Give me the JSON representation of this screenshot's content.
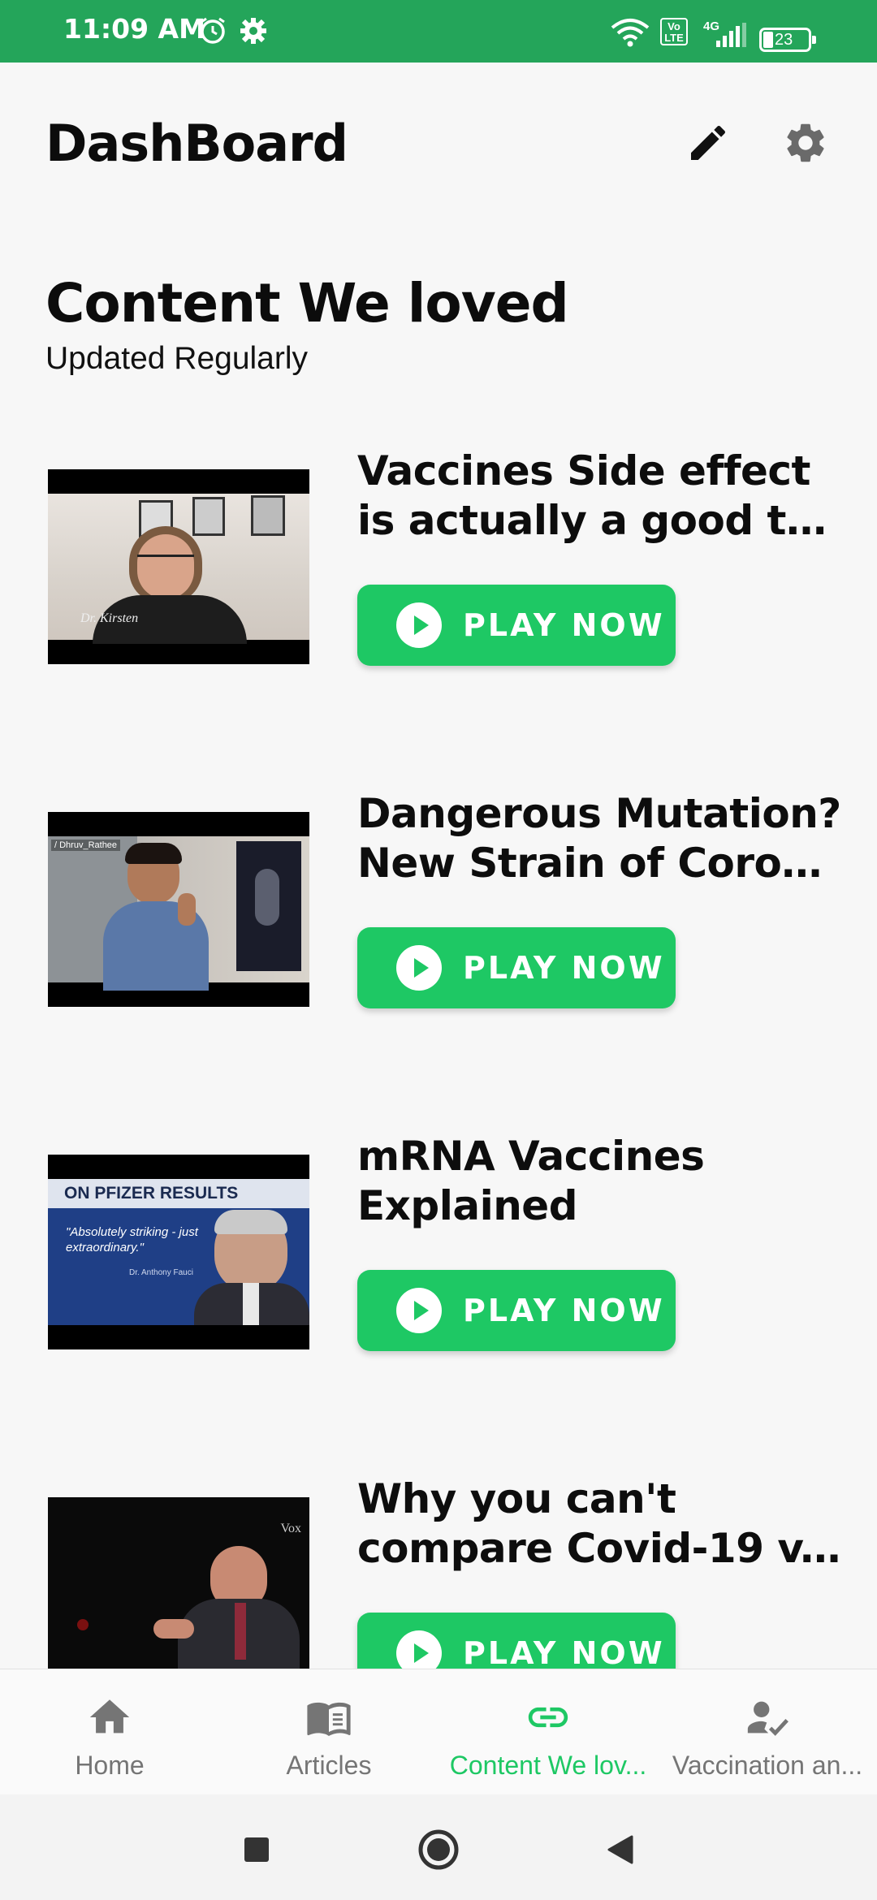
{
  "status_bar": {
    "time": "11:09 AM",
    "battery": "23",
    "volte": "Vo LTE",
    "network": "4G"
  },
  "app_bar": {
    "title": "DashBoard",
    "edit_icon": "pencil-icon",
    "settings_icon": "gear-icon"
  },
  "section": {
    "title": "Content We loved",
    "subtitle": "Updated Regularly"
  },
  "content_items": [
    {
      "title_line1": "Vaccines Side effect",
      "title_line2": "is actually a good th...",
      "play_label": "PLAY NOW",
      "thumb_caption": "Dr. Kirsten"
    },
    {
      "title_line1": "Dangerous Mutation?",
      "title_line2": "New Strain of Coron...",
      "play_label": "PLAY NOW",
      "thumb_caption": "/ Dhruv_Rathee"
    },
    {
      "title_line1": "mRNA Vaccines",
      "title_line2": "Explained",
      "play_label": "PLAY NOW",
      "thumb_caption": "ON PFIZER RESULTS",
      "thumb_quote": "\"Absolutely striking - just extraordinary.\"",
      "thumb_name": "Dr. Anthony Fauci"
    },
    {
      "title_line1": "Why you can't",
      "title_line2": "compare Covid-19 v...",
      "play_label": "PLAY NOW",
      "thumb_caption": "Vox"
    }
  ],
  "bottom_nav": {
    "items": [
      {
        "label": "Home",
        "icon": "home-icon",
        "active": false
      },
      {
        "label": "Articles",
        "icon": "book-icon",
        "active": false
      },
      {
        "label": "Content We lov...",
        "icon": "link-icon",
        "active": true
      },
      {
        "label": "Vaccination an...",
        "icon": "user-check-icon",
        "active": false
      }
    ]
  },
  "colors": {
    "accent": "#1ec864",
    "status_bar": "#24a55a",
    "background": "#f7f7f7"
  }
}
